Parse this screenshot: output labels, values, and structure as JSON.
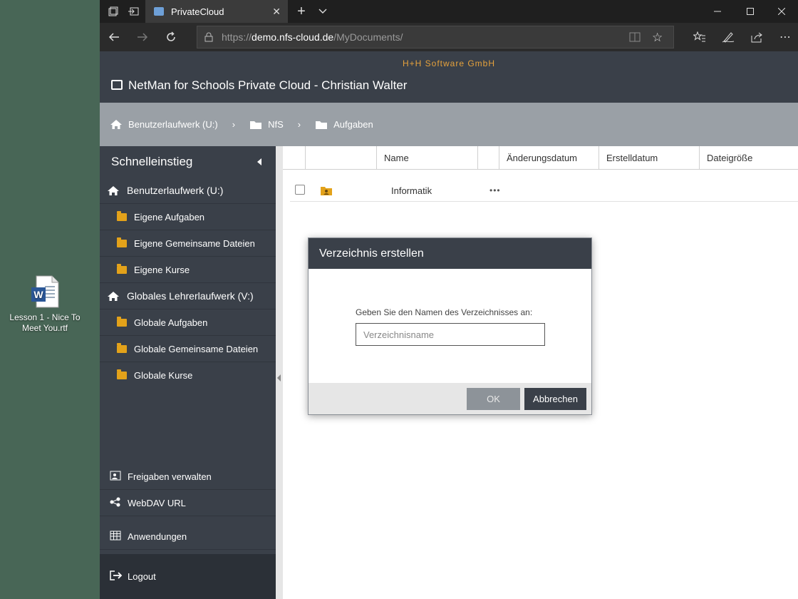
{
  "desktop": {
    "icon_label": "Lesson 1 - Nice To Meet You.rtf"
  },
  "browser": {
    "tab_title": "PrivateCloud",
    "url_prefix": "https://",
    "url_host": "demo.nfs-cloud.de",
    "url_path": "/MyDocuments/"
  },
  "app": {
    "company": "H+H Software GmbH",
    "title": "NetMan for Schools Private Cloud - Christian Walter"
  },
  "breadcrumb": [
    {
      "label": "Benutzerlaufwerk (U:)"
    },
    {
      "label": "NfS"
    },
    {
      "label": "Aufgaben"
    }
  ],
  "sidebar": {
    "heading": "Schnelleinstieg",
    "drive1": "Benutzerlaufwerk (U:)",
    "drive1_items": [
      "Eigene Aufgaben",
      "Eigene Gemeinsame Dateien",
      "Eigene Kurse"
    ],
    "drive2": "Globales Lehrerlaufwerk (V:)",
    "drive2_items": [
      "Globale Aufgaben",
      "Globale Gemeinsame Dateien",
      "Globale Kurse"
    ],
    "links": [
      "Freigaben verwalten",
      "WebDAV URL",
      "Anwendungen"
    ],
    "logout": "Logout"
  },
  "table": {
    "columns": [
      "Name",
      "Änderungsdatum",
      "Erstelldatum",
      "Dateigröße"
    ],
    "rows": [
      {
        "name": "Informatik",
        "menu": "•••"
      }
    ]
  },
  "dialog": {
    "title": "Verzeichnis erstellen",
    "label": "Geben Sie den Namen des Verzeichnisses an:",
    "placeholder": "Verzeichnisname",
    "ok": "OK",
    "cancel": "Abbrechen"
  },
  "colors": {
    "header_bg": "#3a4049",
    "accent_orange": "#e6a23c",
    "folder": "#e3a21a"
  }
}
